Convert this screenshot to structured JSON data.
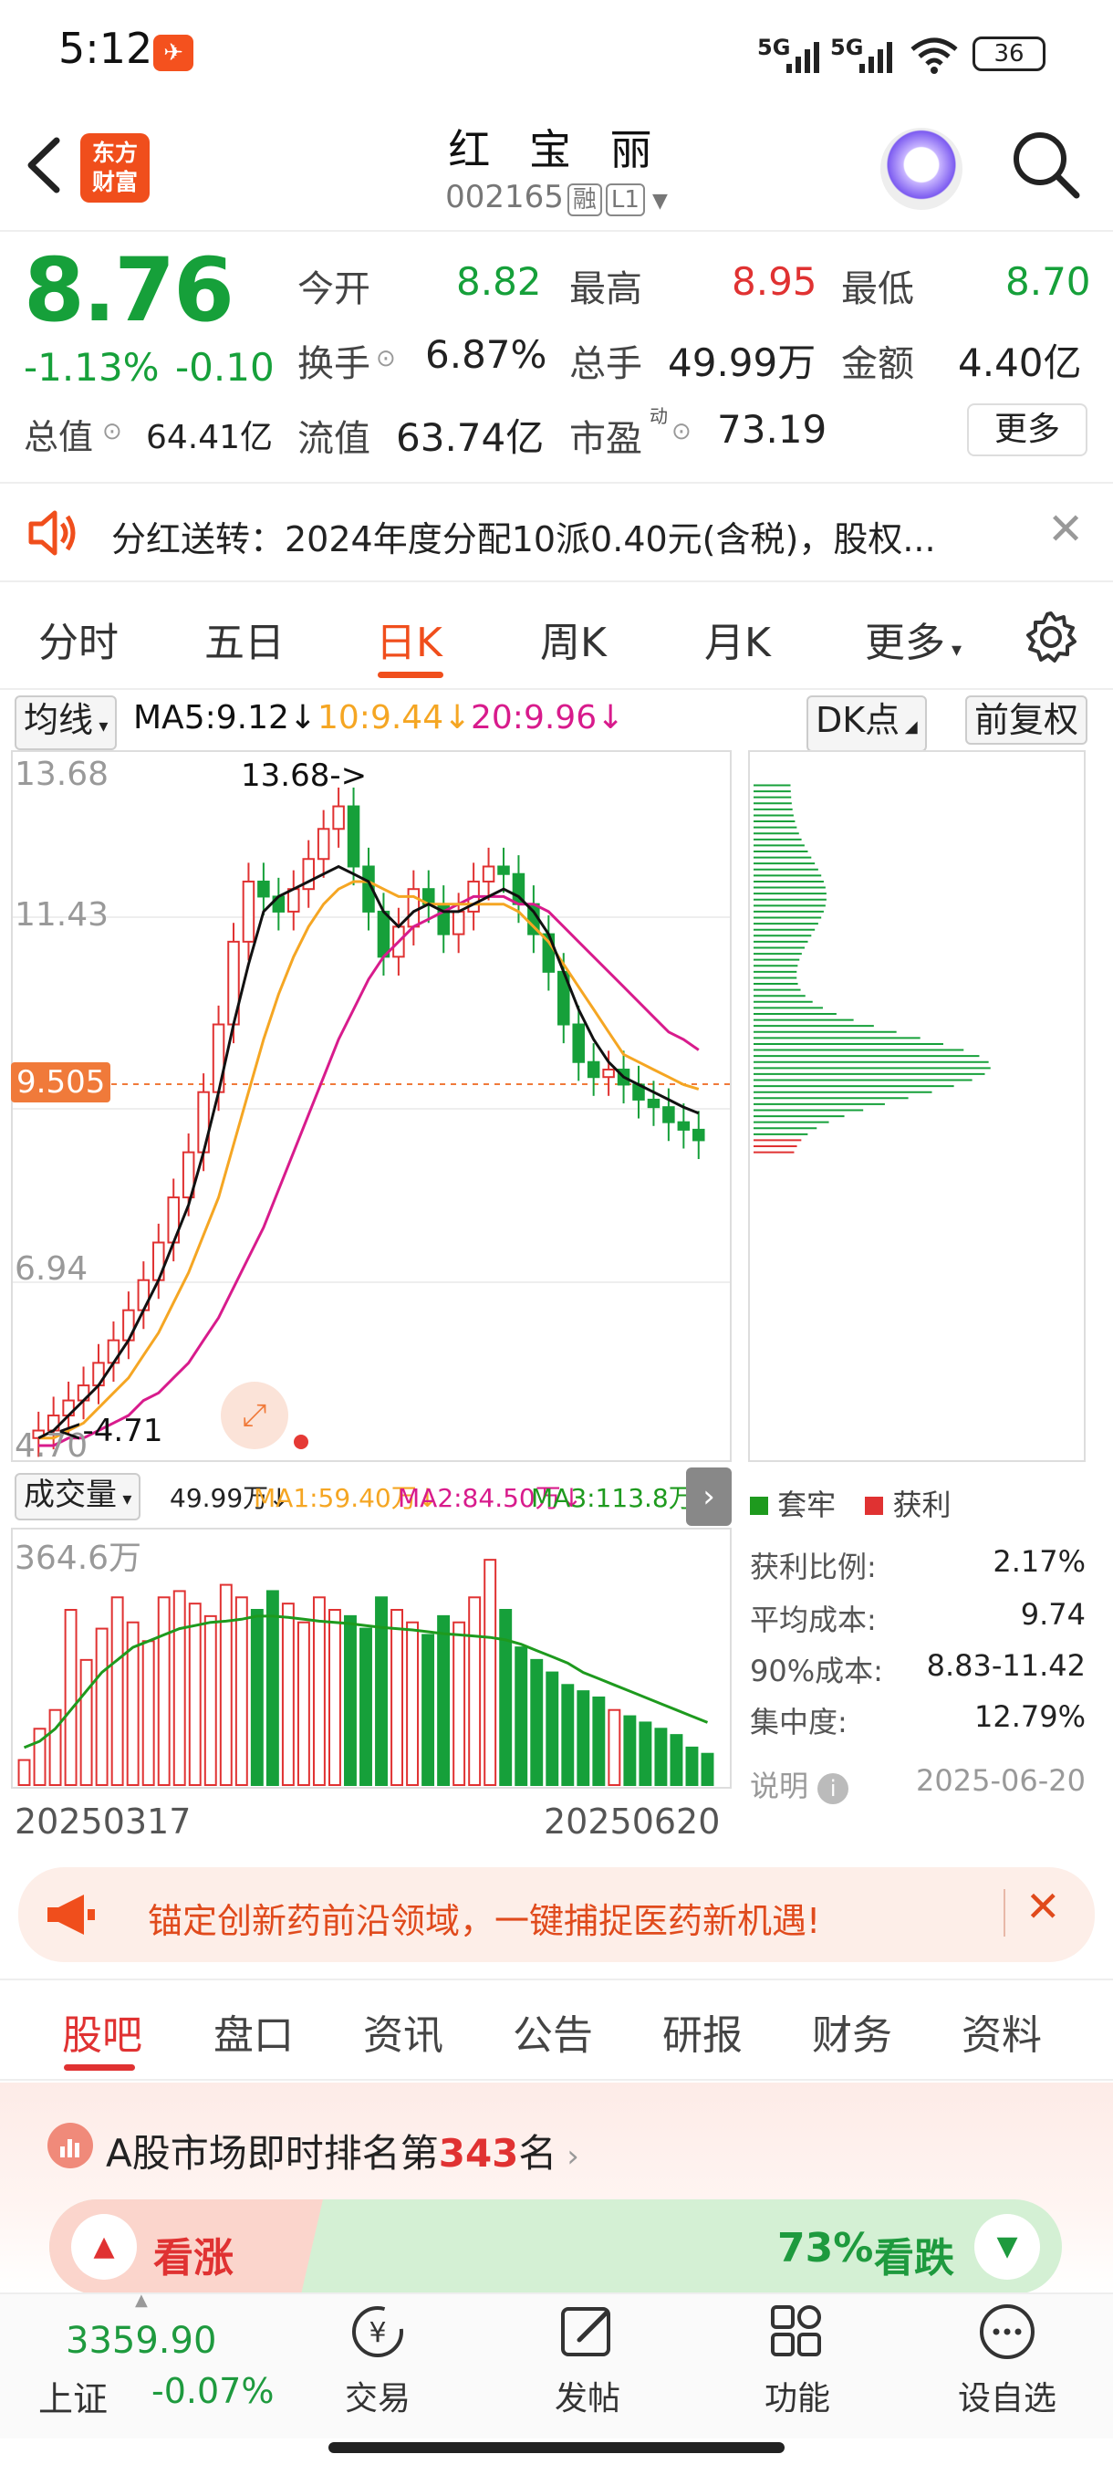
{
  "status": {
    "time": "5:12",
    "sig1": "5G",
    "sig2": "5G",
    "battery": "36"
  },
  "nav": {
    "brand_line1": "东方",
    "brand_line2": "财富",
    "title": "红 宝 丽",
    "code": "002165",
    "tag1": "融",
    "tag2": "L1"
  },
  "quote": {
    "price": "8.76",
    "change_pct": "-1.13%",
    "change": "-0.10",
    "open_label": "今开",
    "open": "8.82",
    "high_label": "最高",
    "high": "8.95",
    "low_label": "最低",
    "low": "8.70",
    "turnover_label": "换手",
    "turnover": "6.87%",
    "volume_label": "总手",
    "volume": "49.99万",
    "amount_label": "金额",
    "amount": "4.40亿",
    "mcap_label": "总值",
    "mcap": "64.41亿",
    "float_label": "流值",
    "float": "63.74亿",
    "pe_label": "市盈",
    "pe_sup": "动",
    "pe": "73.19",
    "more": "更多"
  },
  "notice": {
    "text": "分红送转：2024年度分配10派0.40元(含税)，股权..."
  },
  "tabs": [
    "分时",
    "五日",
    "日K",
    "周K",
    "月K",
    "更多"
  ],
  "ma": {
    "selector": "均线",
    "ma5": "MA5:9.12",
    "ma10": "10:9.44",
    "ma20": "20:9.96",
    "dk": "DK点",
    "fq": "前复权"
  },
  "colors": {
    "up": "#e03232",
    "down": "#16a03a",
    "accent": "#f04e1c",
    "ma5": "#111111",
    "ma10": "#f5a623",
    "ma20": "#d81b8c",
    "vol_ma3": "#1e9a1e"
  },
  "chart_data": {
    "type": "candlestick",
    "y_ticks": [
      "13.68",
      "11.43",
      "6.94",
      "4.70"
    ],
    "current_line": "9.505",
    "max_label": "13.68->",
    "min_label": "<-4.71",
    "closes": [
      4.9,
      5.1,
      5.3,
      5.5,
      5.8,
      6.1,
      6.5,
      6.9,
      7.4,
      8.0,
      8.6,
      9.4,
      10.3,
      11.4,
      12.2,
      12.0,
      11.8,
      12.1,
      12.5,
      12.9,
      13.2,
      12.4,
      11.8,
      11.2,
      11.6,
      12.1,
      11.9,
      11.5,
      11.8,
      12.2,
      12.4,
      12.3,
      11.9,
      11.5,
      11.0,
      10.3,
      9.8,
      9.6,
      9.7,
      9.5,
      9.3,
      9.2,
      9.0,
      8.9,
      8.76
    ],
    "ma5": [
      4.8,
      4.9,
      5.1,
      5.3,
      5.5,
      5.8,
      6.1,
      6.5,
      6.9,
      7.4,
      7.9,
      8.6,
      9.4,
      10.3,
      11.1,
      11.8,
      12.0,
      12.1,
      12.2,
      12.3,
      12.4,
      12.3,
      12.2,
      11.8,
      11.6,
      11.8,
      11.9,
      11.8,
      11.8,
      11.9,
      12.0,
      12.1,
      12.0,
      11.8,
      11.5,
      11.0,
      10.5,
      10.1,
      9.8,
      9.6,
      9.5,
      9.4,
      9.3,
      9.2,
      9.12
    ],
    "ma10": [
      4.8,
      4.8,
      4.9,
      5.0,
      5.2,
      5.4,
      5.6,
      5.9,
      6.2,
      6.6,
      7.0,
      7.5,
      8.0,
      8.7,
      9.4,
      10.1,
      10.7,
      11.2,
      11.6,
      11.9,
      12.1,
      12.2,
      12.2,
      12.1,
      12.0,
      12.0,
      11.9,
      11.9,
      11.9,
      11.9,
      11.9,
      11.9,
      11.8,
      11.6,
      11.4,
      11.1,
      10.8,
      10.5,
      10.2,
      9.9,
      9.8,
      9.7,
      9.6,
      9.5,
      9.44
    ],
    "ma20": [
      4.7,
      4.7,
      4.8,
      4.8,
      4.9,
      5.0,
      5.1,
      5.3,
      5.4,
      5.6,
      5.8,
      6.1,
      6.4,
      6.8,
      7.2,
      7.6,
      8.1,
      8.6,
      9.1,
      9.6,
      10.1,
      10.5,
      10.9,
      11.2,
      11.4,
      11.6,
      11.7,
      11.8,
      11.9,
      12.0,
      12.0,
      12.0,
      11.9,
      11.9,
      11.8,
      11.6,
      11.4,
      11.2,
      11.0,
      10.8,
      10.6,
      10.4,
      10.2,
      10.1,
      9.96
    ],
    "ylim": [
      4.7,
      13.68
    ],
    "volume": {
      "selector": "成交量",
      "vol": "49.99万",
      "ma1": "MA1:59.40万",
      "ma2": "MA2:84.50万",
      "ma3": "MA3:113.8万",
      "max_label": "364.6万",
      "values": [
        40,
        90,
        120,
        280,
        200,
        250,
        300,
        260,
        230,
        300,
        310,
        290,
        270,
        320,
        300,
        280,
        310,
        290,
        260,
        300,
        280,
        270,
        250,
        300,
        280,
        260,
        240,
        270,
        260,
        300,
        360,
        280,
        220,
        200,
        180,
        160,
        150,
        140,
        120,
        110,
        100,
        90,
        80,
        60,
        50
      ],
      "ma3_line": [
        60,
        70,
        90,
        120,
        150,
        180,
        200,
        220,
        230,
        240,
        250,
        255,
        260,
        262,
        265,
        270,
        270,
        268,
        265,
        262,
        260,
        258,
        255,
        252,
        250,
        248,
        245,
        242,
        240,
        238,
        236,
        232,
        225,
        215,
        205,
        195,
        180,
        170,
        160,
        150,
        140,
        130,
        120,
        110,
        100
      ],
      "date_start": "20250317",
      "date_end": "20250620"
    }
  },
  "chips": {
    "legend_trapped": "套牢",
    "legend_profit": "获利",
    "profit_ratio_label": "获利比例:",
    "profit_ratio": "2.17%",
    "avg_cost_label": "平均成本:",
    "avg_cost": "9.74",
    "cost90_label": "90%成本:",
    "cost90": "8.83-11.42",
    "concentration_label": "集中度:",
    "concentration": "12.79%",
    "note_label": "说明",
    "date": "2025-06-20"
  },
  "ad": {
    "text": "锚定创新药前沿领域，一键捕捉医药新机遇!"
  },
  "tabs2": [
    "股吧",
    "盘口",
    "资讯",
    "公告",
    "研报",
    "财务",
    "资料"
  ],
  "rank": {
    "prefix": "A股市场即时排名第",
    "num": "343",
    "suffix": "名"
  },
  "vote": {
    "up": "看涨",
    "down_pct": "73%",
    "down": "看跌"
  },
  "bottom": {
    "index_value": "3359.90",
    "index_name": "上证",
    "index_change": "-0.07%",
    "trade": "交易",
    "post": "发帖",
    "func": "功能",
    "watch": "设自选"
  }
}
